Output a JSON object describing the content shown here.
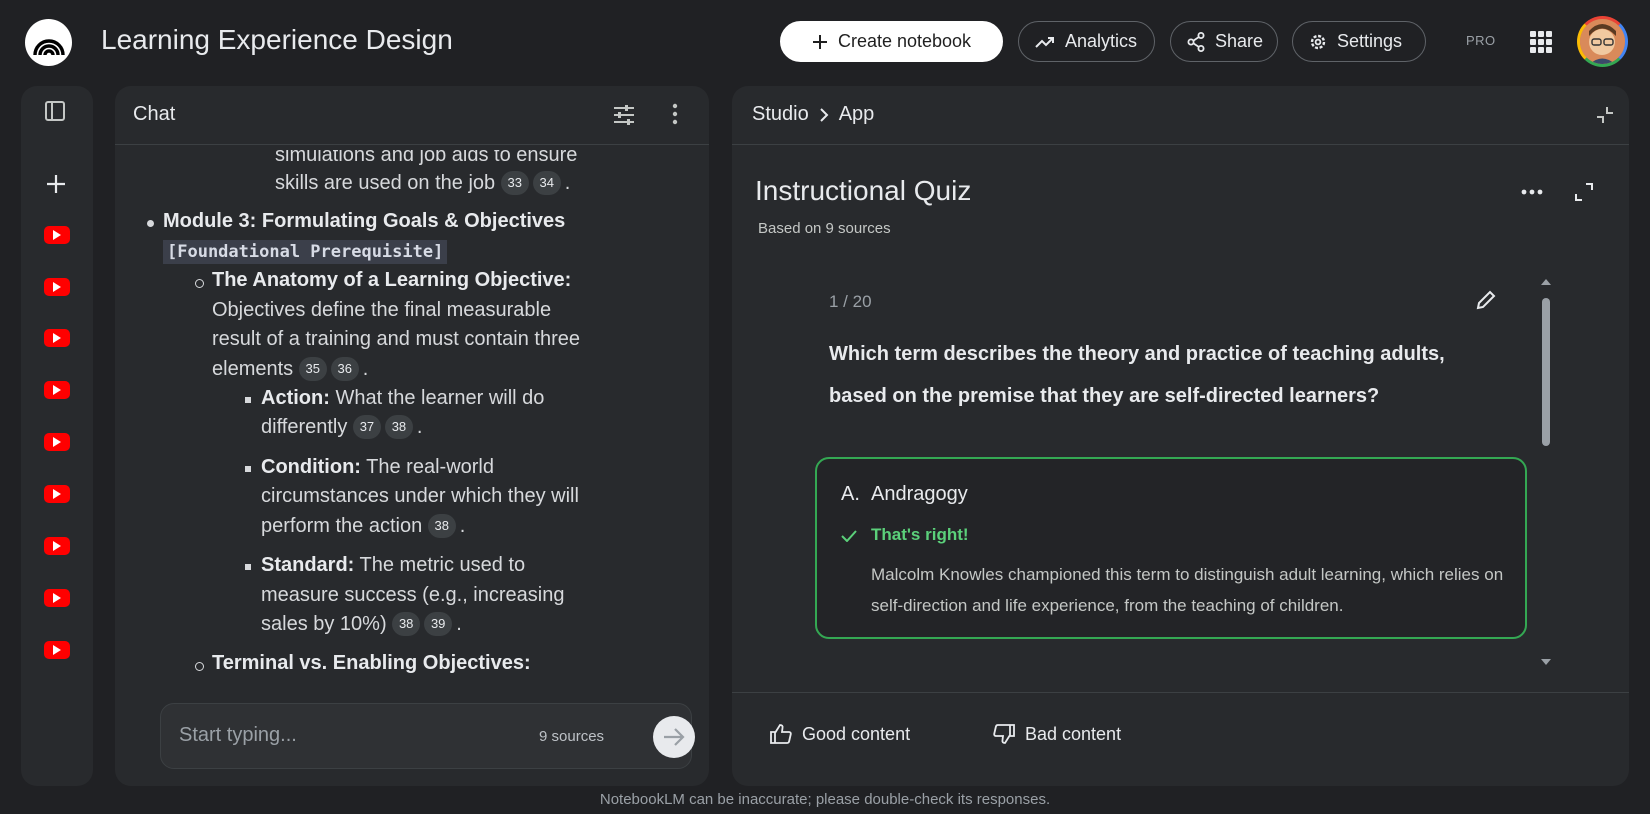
{
  "app": {
    "title": "Learning Experience Design",
    "logo_icon": "notebooklm-logo-icon"
  },
  "toolbar": {
    "create_label": "Create notebook",
    "analytics_label": "Analytics",
    "share_label": "Share",
    "settings_label": "Settings",
    "tier_badge": "PRO"
  },
  "rail": {
    "source_count": 9,
    "source_icon": "youtube-icon"
  },
  "chat": {
    "title": "Chat",
    "frag_top": "simulations and job aids to ensure",
    "line_skills": "skills are used on the job",
    "cites_skills": [
      "33",
      "34"
    ],
    "module3_title": "Module 3: Formulating Goals & Objectives",
    "module3_tag": "[Foundational Prerequisite]",
    "anatomy_title": "The Anatomy of a Learning Objective:",
    "anatomy_l1": "Objectives define the final measurable",
    "anatomy_l2": "result of a training and must contain three",
    "anatomy_l3": "elements",
    "cites_elements": [
      "35",
      "36"
    ],
    "action_label": "Action:",
    "action_l1": " What the learner will do",
    "action_l2": "differently",
    "cites_action": [
      "37",
      "38"
    ],
    "condition_label": "Condition:",
    "condition_l1": " The real-world",
    "condition_l2": "circumstances under which they will",
    "condition_l3": "perform the action",
    "cites_condition": [
      "38"
    ],
    "standard_label": "Standard:",
    "standard_l1": " The metric used to",
    "standard_l2": "measure success (e.g., increasing",
    "standard_l3": "sales by 10%)",
    "cites_standard": [
      "38",
      "39"
    ],
    "terminal_title": "Terminal vs. Enabling Objectives:",
    "period": ".",
    "input_placeholder": "Start typing...",
    "sources_label": "9 sources"
  },
  "studio": {
    "crumb_studio": "Studio",
    "crumb_app": "App",
    "quiz_title": "Instructional Quiz",
    "quiz_sub": "Based on 9 sources",
    "counter": "1 / 20",
    "question": "Which term describes the theory and practice of teaching adults, based on the premise that they are self-directed learners?",
    "answer_letter": "A.",
    "answer_text": "Andragogy",
    "feedback": "That's right!",
    "explanation": "Malcolm Knowles championed this term to distinguish adult learning, which relies on self-direction and life experience, from the teaching of children.",
    "good_label": "Good content",
    "bad_label": "Bad content"
  },
  "footer": {
    "disclaimer": "NotebookLM can be inaccurate; please double-check its responses."
  },
  "colors": {
    "accent_green": "#34a853",
    "youtube_red": "#ff0000",
    "background": "#202124",
    "panel": "#282a2d"
  }
}
